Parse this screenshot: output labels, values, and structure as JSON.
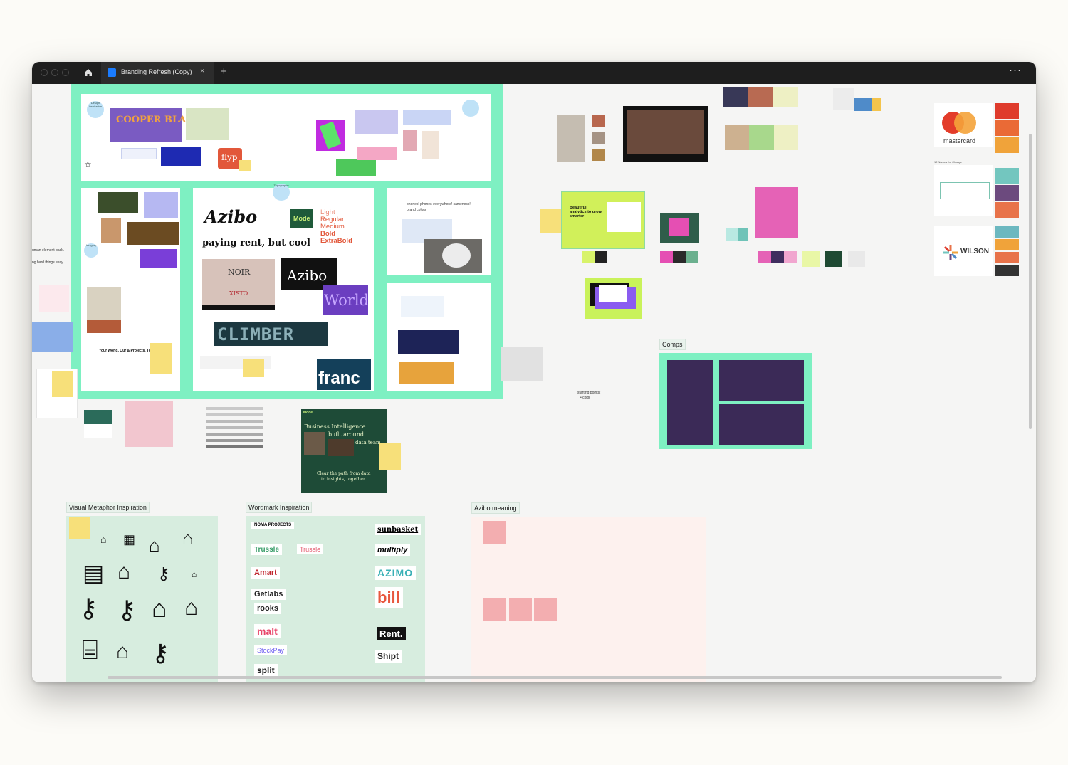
{
  "window": {
    "tab_title": "Branding Refresh (Copy)",
    "close_glyph": "×",
    "new_tab_glyph": "+",
    "menu_glyph": "···",
    "home_icon": "home-icon"
  },
  "moodboard": {
    "logos": {
      "cooper_black": "COOPER BLACK",
      "flyp": "flyp",
      "mode": "Mode",
      "azibo_script": "Azibo",
      "azibo_dark": "Azibo",
      "world": "World",
      "climber": "CLIMBER",
      "franc": "franc",
      "noir": "NOIR",
      "xisto": "XISTO"
    },
    "tagline": "paying rent, but cool",
    "font_weights": [
      "Light",
      "Regular",
      "Medium",
      "Bold",
      "ExtraBold"
    ],
    "phones_note_1": "phones! phones everywhere! sameness!",
    "phones_note_2": "brand colors",
    "your_world": "Your World, Our & Projects. Together.",
    "typography_bubble": "Typography",
    "imagery_bubble": "Imagery",
    "design_bubble": "Design inspiration"
  },
  "left_notes": {
    "human_element": "uman element back.",
    "hard_things": "ng hard things easy."
  },
  "brand_right": {
    "mastercard": "mastercard",
    "wilson": "WILSON",
    "names_for_change": "12 Names for Change"
  },
  "analytics": {
    "headline": "Beautiful analytics to grow smarter"
  },
  "business_intel": {
    "headline_1": "Business Intelligence",
    "headline_2": "built around",
    "headline_3": "data team",
    "sub_1": "Clear the path from data",
    "sub_2": "to insights, together",
    "brand": "Mode"
  },
  "starting_points": {
    "title": "starting points:",
    "item": "• color"
  },
  "sections": {
    "comps": "Comps",
    "visual_metaphor": "Visual Metaphor Inspiration",
    "wordmark": "Wordmark Inspiration",
    "azibo_meaning": "Azibo meaning"
  },
  "wordmarks_left": [
    "NOMA PROJECTS",
    "Trussle",
    "Trussle",
    "Amart",
    "Getlabs",
    "rooks",
    "malt",
    "StockPay",
    "split"
  ],
  "wordmarks_right": [
    "sunbasket",
    "multiply",
    "AZIMO",
    "bill",
    "Rent.",
    "Shipt"
  ],
  "visual_icons": [
    "location-house-icon",
    "building-icon",
    "house-roof-icon",
    "calendar-house-icon",
    "contract-icon",
    "hand-house-icon",
    "key-icon",
    "small-house-icon",
    "hand-key-icon",
    "keys-icon",
    "house-key-icon",
    "handshake-house-icon",
    "for-sale-sign-icon",
    "home-icon",
    "hand-key-2-icon"
  ],
  "colors": {
    "frame_green": "#7ef0c2",
    "comp_purple": "#3b2a57",
    "sticky_yellow": "#f7e07a",
    "sticky_pink": "#f3aeb0",
    "titlebar": "#1e1e1e"
  }
}
